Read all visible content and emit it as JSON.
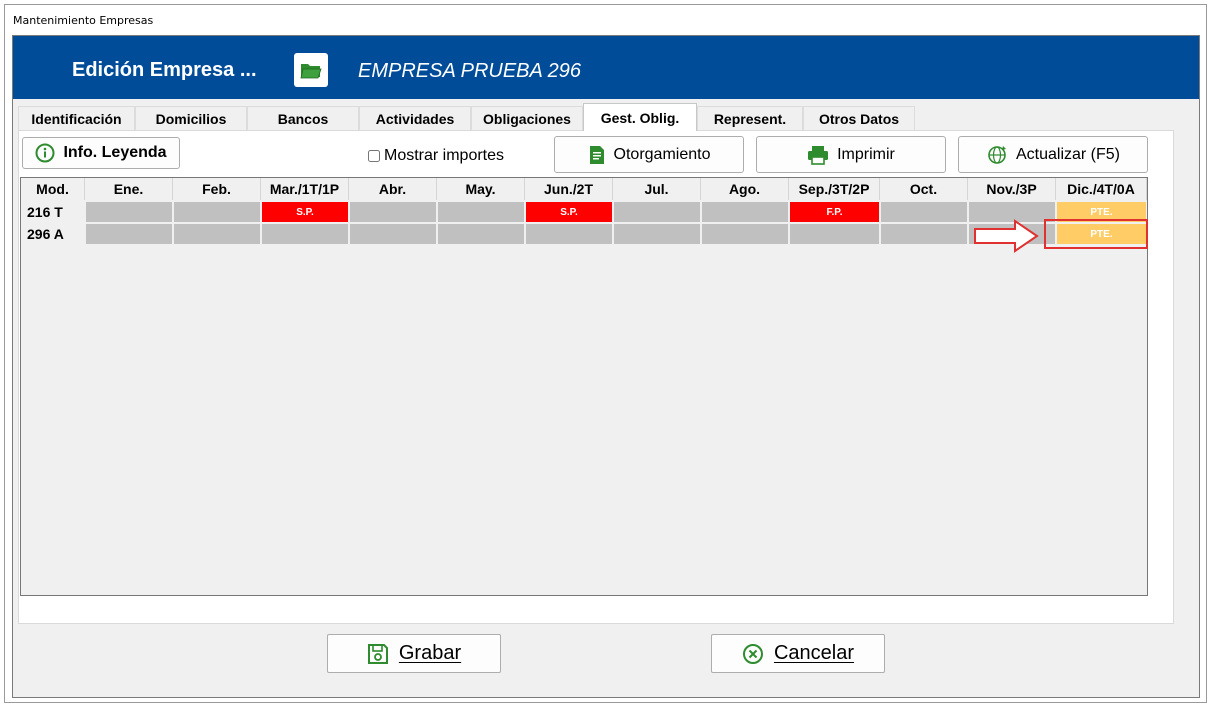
{
  "window": {
    "title": "Mantenimiento Empresas"
  },
  "header": {
    "title": "Edición Empresa ...",
    "company": "EMPRESA PRUEBA 296",
    "color": "#004c99"
  },
  "tabs": [
    {
      "label": "Identificación",
      "active": false
    },
    {
      "label": "Domicilios",
      "active": false
    },
    {
      "label": "Bancos",
      "active": false
    },
    {
      "label": "Actividades",
      "active": false
    },
    {
      "label": "Obligaciones",
      "active": false
    },
    {
      "label": "Gest. Oblig.",
      "active": true
    },
    {
      "label": "Represent.",
      "active": false
    },
    {
      "label": "Otros Datos",
      "active": false
    }
  ],
  "toolbar": {
    "info_label": "Info. Leyenda",
    "show_amounts_label": "Mostrar importes",
    "show_amounts_checked": false,
    "grant_label": "Otorgamiento",
    "print_label": "Imprimir",
    "refresh_label": "Actualizar (F5)"
  },
  "grid": {
    "columns": [
      "Mod.",
      "Ene.",
      "Feb.",
      "Mar./1T/1P",
      "Abr.",
      "May.",
      "Jun./2T",
      "Jul.",
      "Ago.",
      "Sep./3T/2P",
      "Oct.",
      "Nov./3P",
      "Dic./4T/0A"
    ],
    "rows": [
      {
        "mod": "216 T",
        "cells": [
          {
            "text": "",
            "status": "grey"
          },
          {
            "text": "",
            "status": "grey"
          },
          {
            "text": "S.P.",
            "status": "red"
          },
          {
            "text": "",
            "status": "grey"
          },
          {
            "text": "",
            "status": "grey"
          },
          {
            "text": "S.P.",
            "status": "red"
          },
          {
            "text": "",
            "status": "grey"
          },
          {
            "text": "",
            "status": "grey"
          },
          {
            "text": "F.P.",
            "status": "red"
          },
          {
            "text": "",
            "status": "grey"
          },
          {
            "text": "",
            "status": "grey"
          },
          {
            "text": "PTE.",
            "status": "orange"
          }
        ]
      },
      {
        "mod": "296 A",
        "cells": [
          {
            "text": "",
            "status": "grey"
          },
          {
            "text": "",
            "status": "grey"
          },
          {
            "text": "",
            "status": "grey"
          },
          {
            "text": "",
            "status": "grey"
          },
          {
            "text": "",
            "status": "grey"
          },
          {
            "text": "",
            "status": "grey"
          },
          {
            "text": "",
            "status": "grey"
          },
          {
            "text": "",
            "status": "grey"
          },
          {
            "text": "",
            "status": "grey"
          },
          {
            "text": "",
            "status": "grey"
          },
          {
            "text": "",
            "status": "grey"
          },
          {
            "text": "PTE.",
            "status": "orange"
          }
        ]
      }
    ]
  },
  "footer": {
    "save_label": "Grabar",
    "cancel_label": "Cancelar"
  },
  "colors": {
    "red": "#ff0000",
    "orange": "#ffcc66",
    "grey": "#c0c0c0",
    "icon_green": "#2e8b2e",
    "highlight": "#e03030"
  }
}
